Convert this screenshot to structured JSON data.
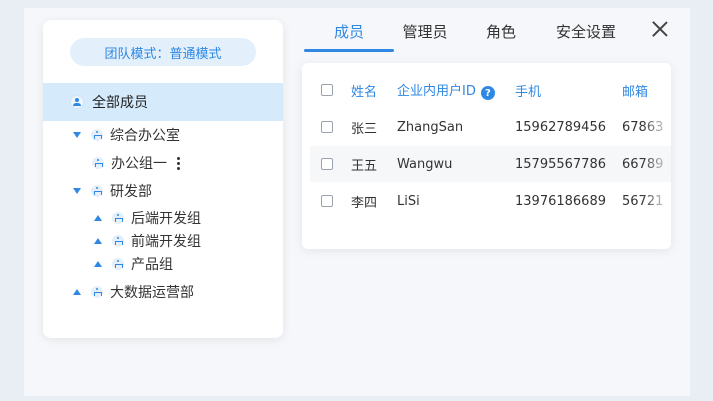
{
  "sidebar": {
    "mode_label": "团队模式：普通模式",
    "all_members": "全部成员",
    "tree": [
      {
        "label": "综合办公室"
      },
      {
        "label": "办公组一"
      },
      {
        "label": "研发部"
      },
      {
        "label": "后端开发组"
      },
      {
        "label": "前端开发组"
      },
      {
        "label": "产品组"
      },
      {
        "label": "大数据运营部"
      }
    ]
  },
  "tabs": [
    {
      "label": "成员",
      "active": true
    },
    {
      "label": "管理员"
    },
    {
      "label": "角色"
    },
    {
      "label": "安全设置"
    }
  ],
  "table": {
    "headers": {
      "name": "姓名",
      "uid": "企业内用户ID",
      "phone": "手机",
      "email": "邮箱"
    },
    "help_glyph": "?",
    "rows": [
      {
        "name": "张三",
        "uid": "ZhangSan",
        "phone": "15962789456",
        "email": "67863"
      },
      {
        "name": "王五",
        "uid": "Wangwu",
        "phone": "15795567786",
        "email": "66789"
      },
      {
        "name": "李四",
        "uid": "LiSi",
        "phone": "13976186689",
        "email": "56721"
      }
    ]
  },
  "colors": {
    "accent": "#2f88e3",
    "selected_bg": "#d5ebfb",
    "badge_bg": "#e3f0fc"
  }
}
